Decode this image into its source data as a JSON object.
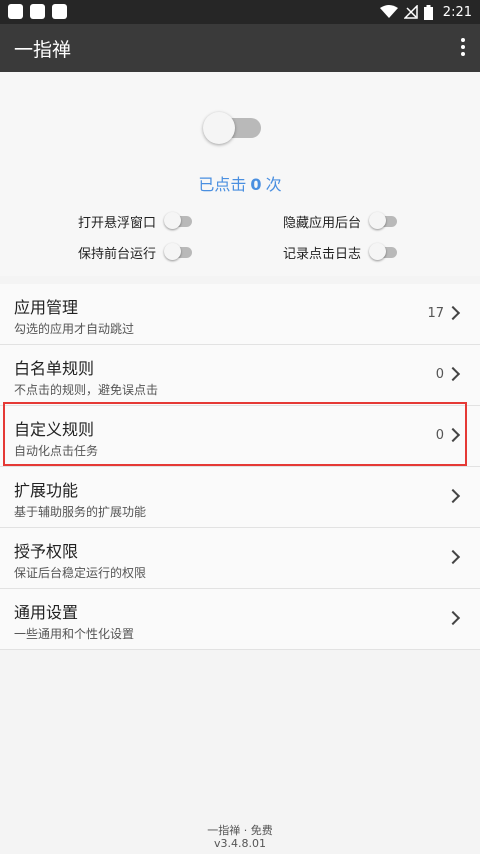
{
  "status_bar": {
    "time": "2:21"
  },
  "app_bar": {
    "title": "一指禅"
  },
  "control": {
    "count_prefix": "已点击",
    "count_value": "0",
    "count_suffix": "次",
    "options": [
      {
        "label": "打开悬浮窗口"
      },
      {
        "label": "隐藏应用后台"
      },
      {
        "label": "保持前台运行"
      },
      {
        "label": "记录点击日志"
      }
    ]
  },
  "menu": [
    {
      "title": "应用管理",
      "subtitle": "勾选的应用才自动跳过",
      "count": "17"
    },
    {
      "title": "白名单规则",
      "subtitle": "不点击的规则，避免误点击",
      "count": "0"
    },
    {
      "title": "自定义规则",
      "subtitle": "自动化点击任务",
      "count": "0"
    },
    {
      "title": "扩展功能",
      "subtitle": "基于辅助服务的扩展功能",
      "count": ""
    },
    {
      "title": "授予权限",
      "subtitle": "保证后台稳定运行的权限",
      "count": ""
    },
    {
      "title": "通用设置",
      "subtitle": "一些通用和个性化设置",
      "count": ""
    }
  ],
  "footer": {
    "line1": "一指禅 · 免费",
    "line2": "v3.4.8.01"
  },
  "colors": {
    "accent": "#4a8fe0",
    "highlight": "#e53935",
    "app_bar": "#3a3a3a"
  }
}
